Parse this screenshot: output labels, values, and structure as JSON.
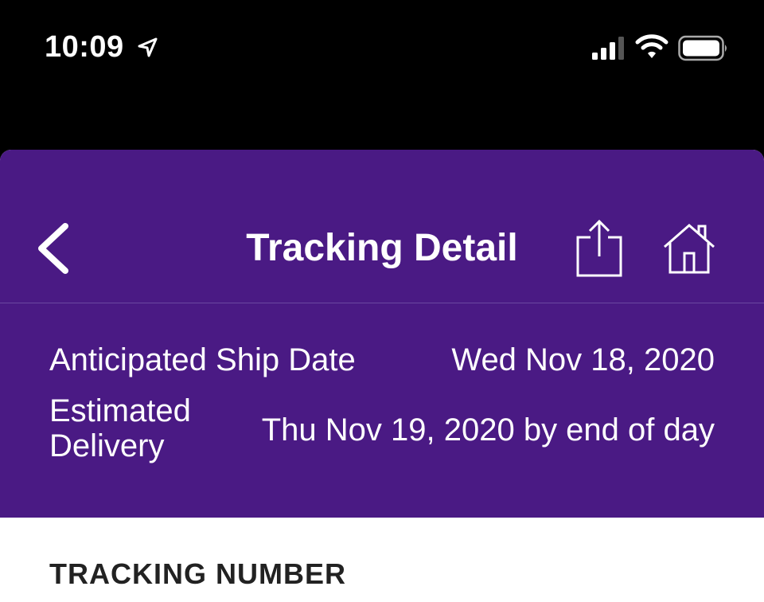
{
  "status_bar": {
    "time": "10:09",
    "icons": [
      "location-arrow-icon",
      "cellular-signal-icon",
      "wifi-icon",
      "battery-icon"
    ]
  },
  "navbar": {
    "title": "Tracking Detail",
    "back_icon": "chevron-left-icon",
    "share_icon": "share-icon",
    "home_icon": "home-icon"
  },
  "shipment": {
    "ship_label": "Anticipated Ship Date",
    "ship_value": "Wed Nov 18, 2020",
    "delivery_label": "Estimated Delivery",
    "delivery_value": "Thu Nov 19, 2020 by end of day"
  },
  "tracking": {
    "section_title": "TRACKING NUMBER"
  },
  "colors": {
    "header_bg": "#4a1a84",
    "status_bg": "#000000",
    "text_on_header": "#ffffff",
    "section_title": "#222222"
  }
}
